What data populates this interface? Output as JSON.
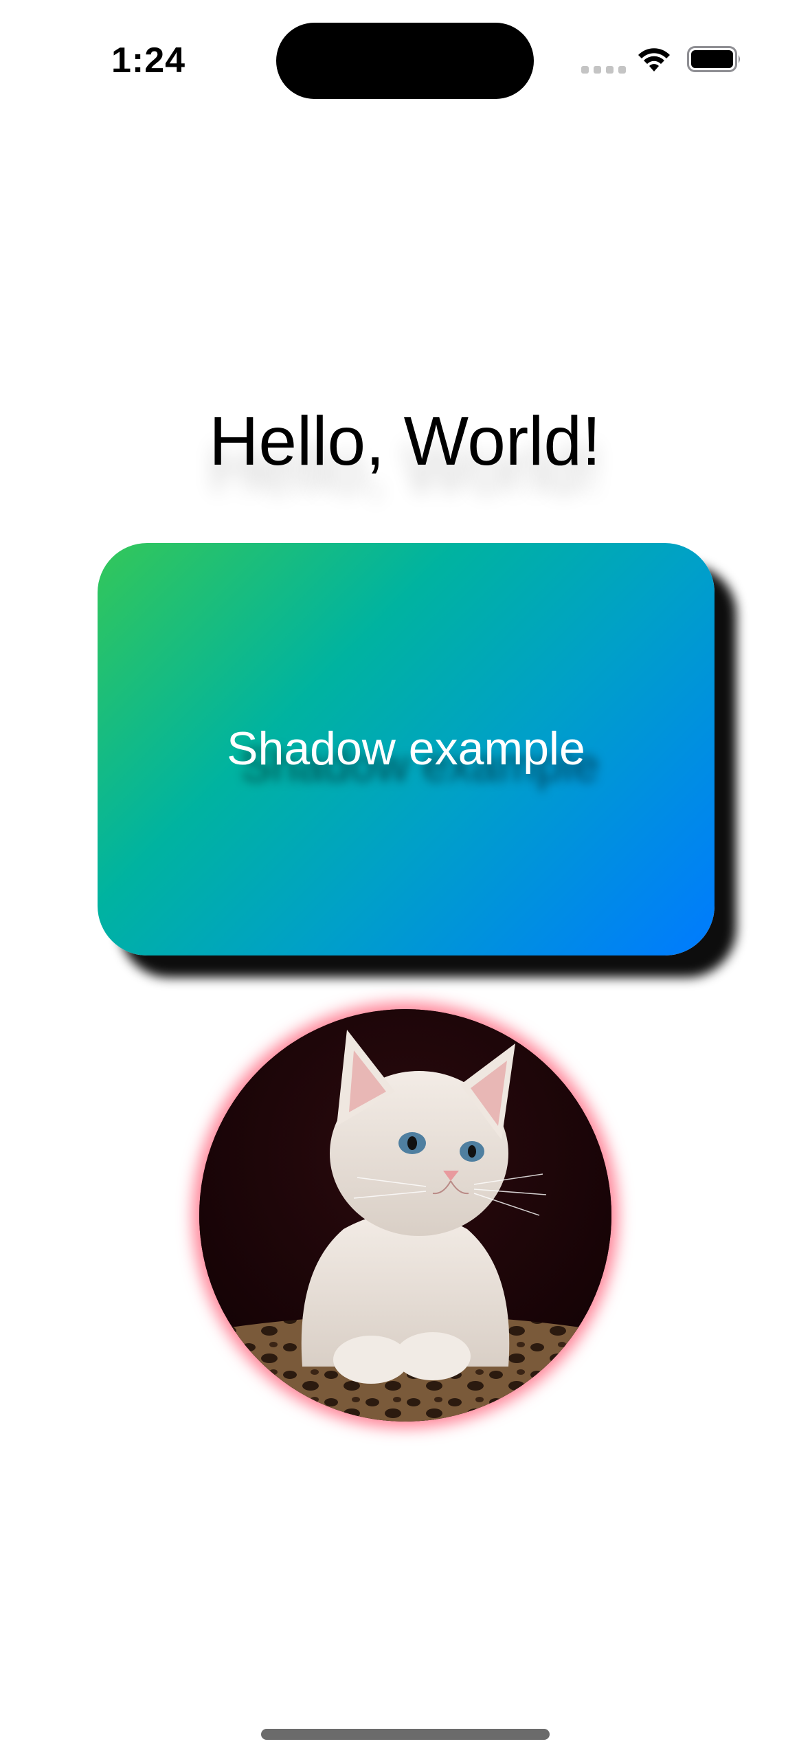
{
  "status_bar": {
    "time": "1:24"
  },
  "content": {
    "title": "Hello, World!",
    "card_label": "Shadow example",
    "card_gradient": [
      "#34c759",
      "#007aff"
    ],
    "image_glow_color": "#ff4664"
  },
  "icons": {
    "wifi": "wifi-icon",
    "battery": "battery-icon",
    "cat": "cat-photo"
  }
}
